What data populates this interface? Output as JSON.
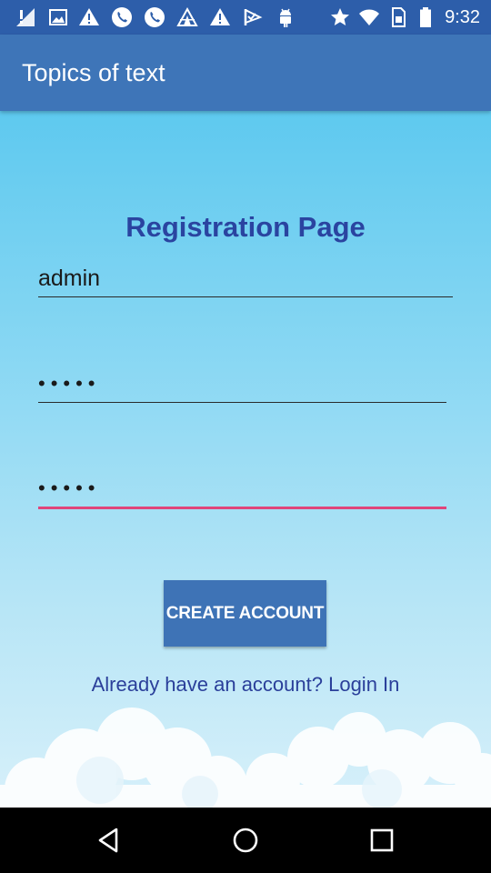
{
  "status_bar": {
    "time": "9:32",
    "background_color": "#2d5eaa",
    "left_icons": [
      "alert-signal-icon",
      "image-icon",
      "warning-icon",
      "phone-icon",
      "phone-icon",
      "camp-icon",
      "warning-icon",
      "check-flag-icon",
      "android-icon"
    ],
    "right_icons": [
      "star-icon",
      "wifi-icon",
      "sim-card-icon",
      "battery-icon"
    ]
  },
  "app_bar": {
    "title": "Topics of text",
    "background_color": "#3e75b8"
  },
  "registration": {
    "heading": "Registration Page",
    "username_value": "admin",
    "password_value": "•••••",
    "confirm_password_value": "•••••",
    "create_button_label": "CREATE ACCOUNT",
    "login_link_text": "Already have an account? Login In",
    "accent_color": "#e0457b",
    "heading_color": "#2a44a0"
  },
  "nav_bar": {
    "buttons": [
      "back-icon",
      "home-icon",
      "recents-icon"
    ]
  }
}
